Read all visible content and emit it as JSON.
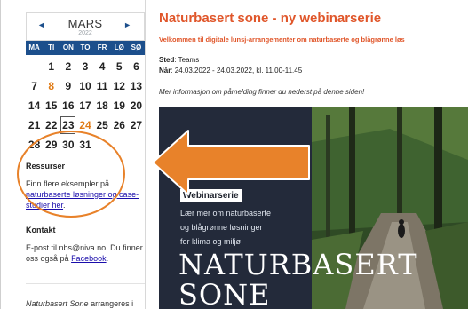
{
  "calendar": {
    "month": "MARS",
    "year": "2022",
    "prev_label": "◄",
    "next_label": "►",
    "weekdays": [
      "MA",
      "TI",
      "ON",
      "TO",
      "FR",
      "LØ",
      "SØ"
    ],
    "rows": [
      [
        "",
        "1",
        "2",
        "3",
        "4",
        "5",
        "6"
      ],
      [
        "7",
        "8",
        "9",
        "10",
        "11",
        "12",
        "13"
      ],
      [
        "14",
        "15",
        "16",
        "17",
        "18",
        "19",
        "20"
      ],
      [
        "21",
        "22",
        "23",
        "24",
        "25",
        "26",
        "27"
      ],
      [
        "28",
        "29",
        "30",
        "31",
        "",
        "",
        ""
      ]
    ],
    "event_days": [
      "8",
      "24"
    ],
    "today": "23"
  },
  "sidebar": {
    "resources_title": "Ressurser",
    "resources_text": "Finn flere eksempler på",
    "resources_link": "naturbaserte løsninger og case-studier her",
    "resources_end": ".",
    "contact_title": "Kontakt",
    "contact_text": "E-post til nbs@niva.no. Du finner oss også på",
    "contact_link": "Facebook",
    "contact_end": ".",
    "footer_em": "Naturbasert Sone",
    "footer_text": "arrangeres i samarbeid med flere prosjekter"
  },
  "main": {
    "title": "Naturbasert sone - ny webinarserie",
    "subtitle": "Velkommen til digitale lunsj-arrangementer om naturbaserte og blågrønne løs",
    "place_label": "Sted",
    "place_value": ": Teams",
    "time_label": "Når",
    "time_value": ": 24.03.2022 - 24.03.2022, kl. 11.00-11.45",
    "note": "Mer informasjon om påmelding finner du nederst på denne siden!"
  },
  "banner": {
    "tag": "Webinarserie",
    "line1": "Lær mer om naturbaserte",
    "line2": "og blågrønne løsninger",
    "line3": "for klima og miljø",
    "big1": "NATURBASERT",
    "big2": "SONE"
  },
  "colors": {
    "accent": "#e0562a",
    "calendar_header": "#1c4f8c",
    "event_day": "#e07b16",
    "annotation": "#e8822a",
    "banner_bg": "#232a3a"
  }
}
